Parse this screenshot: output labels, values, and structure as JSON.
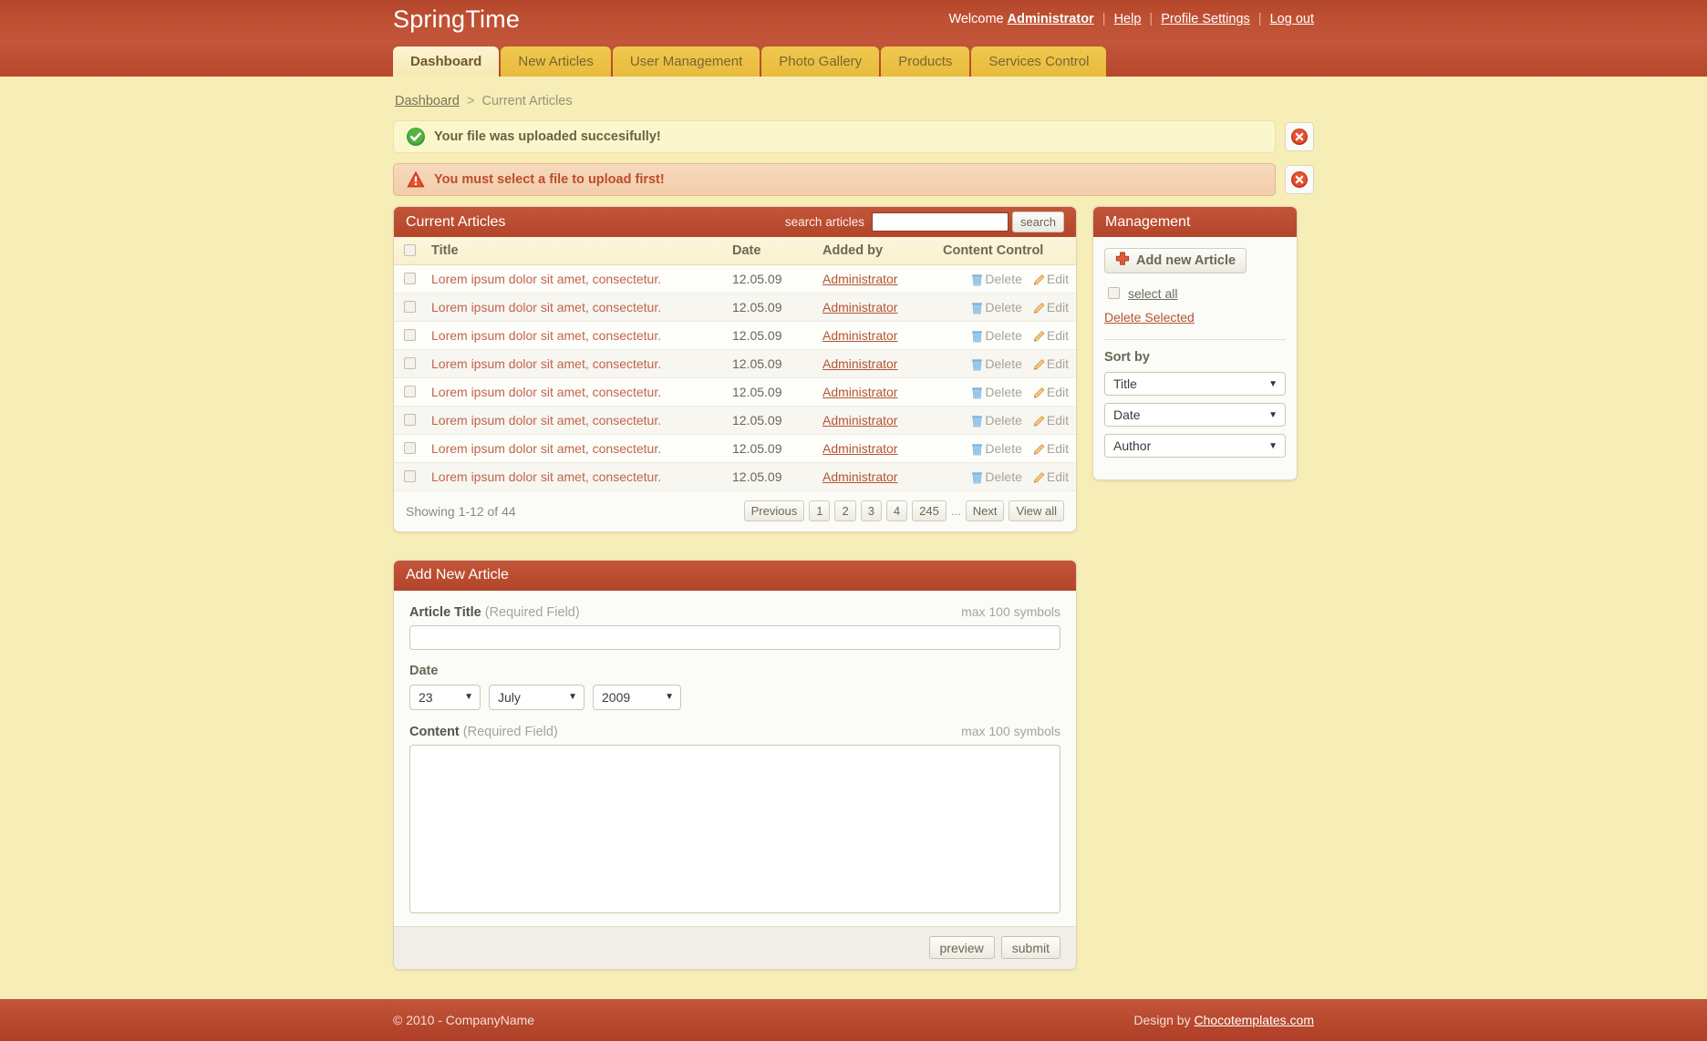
{
  "header": {
    "logo": "SpringTime",
    "welcome_text": "Welcome",
    "user": "Administrator",
    "links": [
      {
        "label": "Help"
      },
      {
        "label": "Profile Settings"
      },
      {
        "label": "Log out"
      }
    ],
    "separator": "|"
  },
  "nav": {
    "tabs": [
      {
        "label": "Dashboard",
        "active": true
      },
      {
        "label": "New Articles",
        "active": false
      },
      {
        "label": "User Management",
        "active": false
      },
      {
        "label": "Photo Gallery",
        "active": false
      },
      {
        "label": "Products",
        "active": false
      },
      {
        "label": "Services Control",
        "active": false
      }
    ]
  },
  "breadcrumb": {
    "root": "Dashboard",
    "arrow": ">",
    "current": "Current Articles"
  },
  "messages": [
    {
      "type": "success",
      "icon": "check-circle-icon",
      "text": "Your file was uploaded succesifully!",
      "close_icon": "close-circle-icon"
    },
    {
      "type": "error",
      "icon": "warning-triangle-icon",
      "text": "You must select a file to upload first!",
      "close_icon": "close-circle-icon"
    }
  ],
  "articles_panel": {
    "title": "Current Articles",
    "search_label": "search articles",
    "search_value": "",
    "search_placeholder": "",
    "search_button": "search",
    "columns": [
      "Title",
      "Date",
      "Added by",
      "Content Control"
    ],
    "delete_label": "Delete",
    "edit_label": "Edit",
    "rows": [
      {
        "title": "Lorem ipsum dolor sit amet, consectetur.",
        "date": "12.05.09",
        "added_by": "Administrator"
      },
      {
        "title": "Lorem ipsum dolor sit amet, consectetur.",
        "date": "12.05.09",
        "added_by": "Administrator"
      },
      {
        "title": "Lorem ipsum dolor sit amet, consectetur.",
        "date": "12.05.09",
        "added_by": "Administrator"
      },
      {
        "title": "Lorem ipsum dolor sit amet, consectetur.",
        "date": "12.05.09",
        "added_by": "Administrator"
      },
      {
        "title": "Lorem ipsum dolor sit amet, consectetur.",
        "date": "12.05.09",
        "added_by": "Administrator"
      },
      {
        "title": "Lorem ipsum dolor sit amet, consectetur.",
        "date": "12.05.09",
        "added_by": "Administrator"
      },
      {
        "title": "Lorem ipsum dolor sit amet, consectetur.",
        "date": "12.05.09",
        "added_by": "Administrator"
      },
      {
        "title": "Lorem ipsum dolor sit amet, consectetur.",
        "date": "12.05.09",
        "added_by": "Administrator"
      }
    ],
    "pagination": {
      "showing": "Showing 1-12 of 44",
      "previous": "Previous",
      "pages": [
        "1",
        "2",
        "3",
        "4",
        "245"
      ],
      "ellipsis": "...",
      "next": "Next",
      "view_all": "View all"
    }
  },
  "management_panel": {
    "title": "Management",
    "add_button": "Add new Article",
    "add_icon": "plus-badge-icon",
    "select_all": "select all",
    "delete_selected": "Delete Selected",
    "sort_by_label": "Sort by",
    "sorts": [
      {
        "name": "title",
        "value": "Title"
      },
      {
        "name": "date",
        "value": "Date"
      },
      {
        "name": "author",
        "value": "Author"
      }
    ]
  },
  "add_article_form": {
    "title": "Add New Article",
    "article_title_label": "Article Title",
    "article_title_required": "(Required Field)",
    "article_title_hint": "max 100 symbols",
    "article_title_value": "",
    "date_label": "Date",
    "date_day": "23",
    "date_month": "July",
    "date_year": "2009",
    "content_label": "Content",
    "content_required": "(Required Field)",
    "content_hint": "max 100 symbols",
    "content_value": "",
    "preview_button": "preview",
    "submit_button": "submit"
  },
  "footer": {
    "copyright": "© 2010 - CompanyName",
    "design_by": "Design by",
    "design_link": "Chocotemplates.com"
  },
  "colors": {
    "brand_red": "#b3452a",
    "panel_header": "#c2553a",
    "tab_gold": "#e9bb3c",
    "tab_active": "#fcf3cf",
    "page_bg": "#f7edb6",
    "link_red": "#b5562f",
    "success_bg": "#fbf7cd",
    "error_bg": "#f3cdab",
    "delete_icon": "#8fc4e8",
    "edit_icon": "#e2a04a"
  }
}
